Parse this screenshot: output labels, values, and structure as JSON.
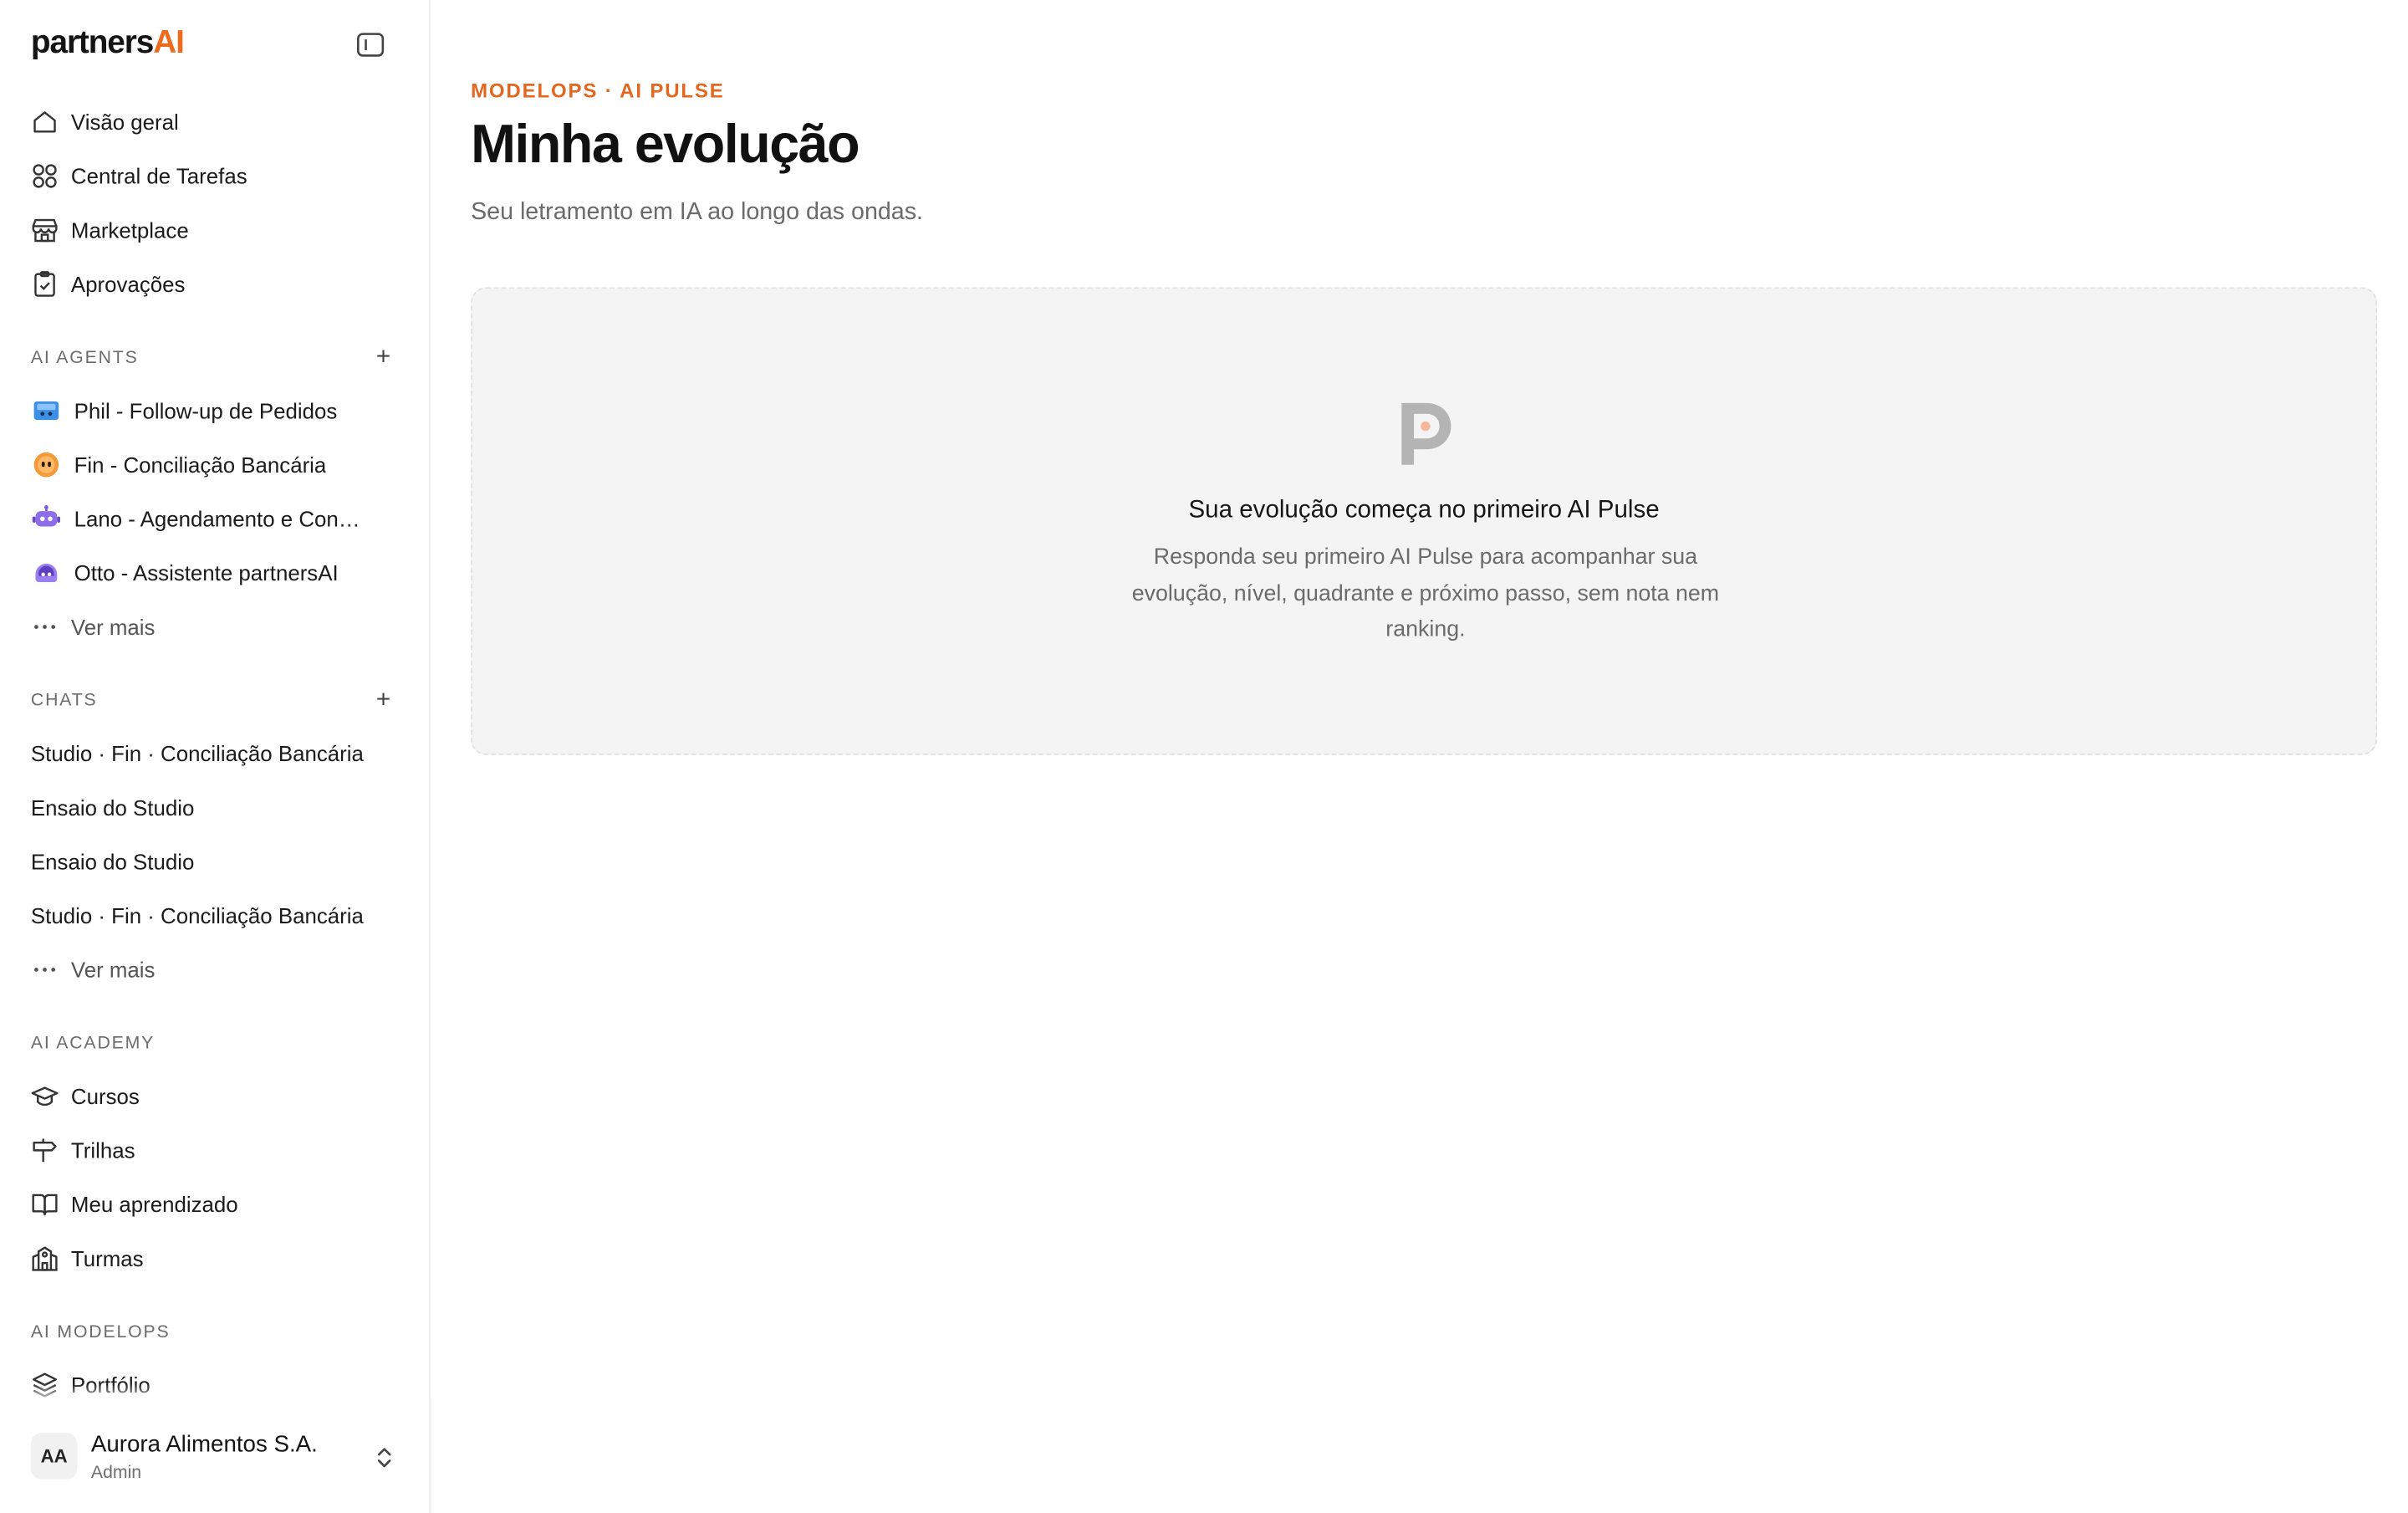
{
  "brand": {
    "logo_main": "partners",
    "logo_accent": "AI",
    "accent_color": "#ee6a1f"
  },
  "sidebar": {
    "primary": [
      {
        "label": "Visão geral",
        "icon": "home-icon"
      },
      {
        "label": "Central de Tarefas",
        "icon": "grid-icon"
      },
      {
        "label": "Marketplace",
        "icon": "store-icon"
      },
      {
        "label": "Aprovações",
        "icon": "clipboard-check-icon"
      }
    ],
    "agents_section": {
      "title": "AI AGENTS",
      "add": "+",
      "items": [
        {
          "label": "Phil - Follow-up de Pedidos",
          "icon": "phil-avatar-icon"
        },
        {
          "label": "Fin - Conciliação Bancária",
          "icon": "fin-avatar-icon"
        },
        {
          "label": "Lano - Agendamento e Con…",
          "icon": "lano-robot-icon"
        },
        {
          "label": "Otto - Assistente partnersAI",
          "icon": "otto-avatar-icon"
        }
      ],
      "more": "Ver mais"
    },
    "chats_section": {
      "title": "CHATS",
      "add": "+",
      "items": [
        "Studio · Fin · Conciliação Bancária",
        "Ensaio do Studio",
        "Ensaio do Studio",
        "Studio · Fin · Conciliação Bancária"
      ],
      "more": "Ver mais"
    },
    "academy_section": {
      "title": "AI ACADEMY",
      "items": [
        {
          "label": "Cursos",
          "icon": "graduation-cap-icon"
        },
        {
          "label": "Trilhas",
          "icon": "signpost-icon"
        },
        {
          "label": "Meu aprendizado",
          "icon": "book-open-icon"
        },
        {
          "label": "Turmas",
          "icon": "school-building-icon"
        }
      ]
    },
    "modelops_section": {
      "title": "AI MODELOPS",
      "items": [
        {
          "label": "Portfólio",
          "icon": "layers-icon"
        }
      ]
    },
    "footer": {
      "initials": "AA",
      "org_name": "Aurora Alimentos S.A.",
      "role": "Admin"
    }
  },
  "main": {
    "eyebrow": "MODELOPS · AI PULSE",
    "title": "Minha evolução",
    "subtitle": "Seu letramento em IA ao longo das ondas.",
    "empty_state": {
      "title": "Sua evolução começa no primeiro AI Pulse",
      "description": "Responda seu primeiro AI Pulse para acompanhar sua evolução, nível, quadrante e próximo passo, sem nota nem ranking."
    }
  }
}
